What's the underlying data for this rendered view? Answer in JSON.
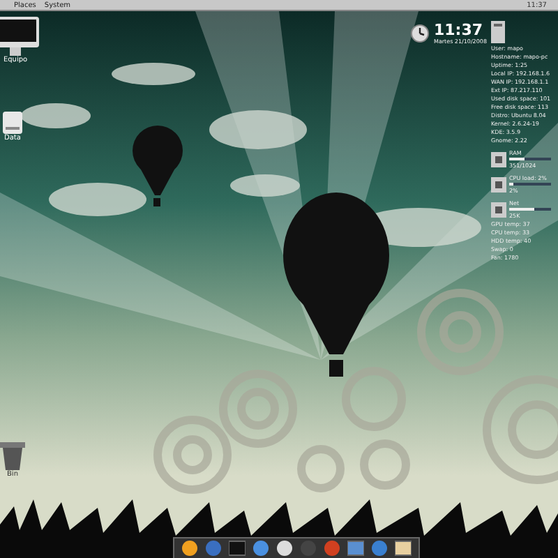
{
  "top_panel": {
    "menus": [
      "Places",
      "System"
    ],
    "tray_time": "11:37"
  },
  "desktop_icons": [
    {
      "kind": "monitor",
      "label": "Equipo"
    },
    {
      "kind": "drive",
      "label": "Data"
    },
    {
      "kind": "trash",
      "label": "Bin"
    }
  ],
  "conky": {
    "time": "11:37",
    "date": "Martes 21/10/2008",
    "system_lines": [
      "User: mapo",
      "Hostname: mapo-pc",
      "Uptime: 1:25",
      "Local IP: 192.168.1.6",
      "WAN IP: 192.168.1.1",
      "Ext IP: 87.217.110",
      "Used disk space: 101",
      "Free disk space: 113",
      "Distro: Ubuntu 8.04",
      "Kernel: 2.6.24-19",
      "KDE: 3.5.9",
      "Gnome: 2.22"
    ],
    "meters": [
      {
        "label": "RAM",
        "level": 0.35,
        "reading": "351/1024"
      },
      {
        "label": "CPU load: 2%",
        "level": 0.1,
        "reading": "2%"
      },
      {
        "label": "Net",
        "level": 0.6,
        "reading": "25K"
      }
    ],
    "temps": [
      "GPU temp: 37",
      "CPU temp: 33",
      "HDD temp: 40",
      "Swap: 0",
      "Fan: 1780"
    ]
  }
}
